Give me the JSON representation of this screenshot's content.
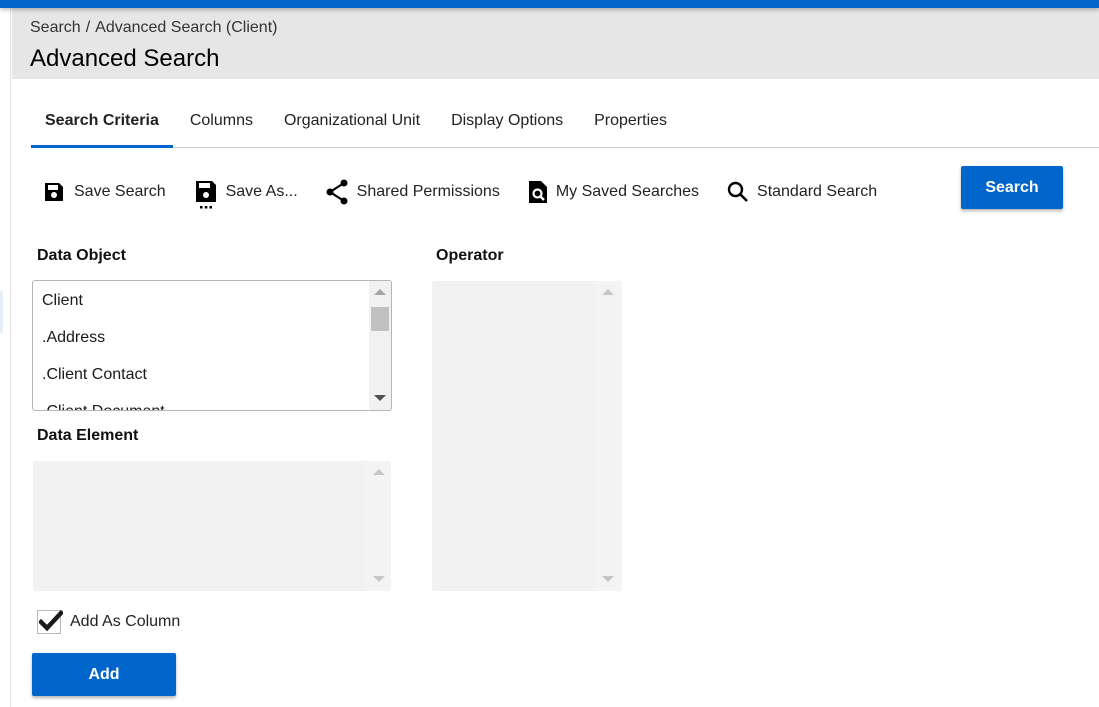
{
  "breadcrumb": {
    "items": [
      "Search",
      "Advanced Search (Client)"
    ],
    "separator": "/"
  },
  "page": {
    "title": "Advanced Search"
  },
  "tabs": [
    {
      "label": "Search Criteria",
      "active": true
    },
    {
      "label": "Columns",
      "active": false
    },
    {
      "label": "Organizational Unit",
      "active": false
    },
    {
      "label": "Display Options",
      "active": false
    },
    {
      "label": "Properties",
      "active": false
    }
  ],
  "toolbar": {
    "save_search": {
      "label": "Save Search",
      "icon": "floppy-disk-icon"
    },
    "save_as": {
      "label": "Save As...",
      "icon": "floppy-disk-more-icon"
    },
    "shared_permissions": {
      "label": "Shared Permissions",
      "icon": "share-icon"
    },
    "my_saved_searches": {
      "label": "My Saved Searches",
      "icon": "document-search-icon"
    },
    "standard_search": {
      "label": "Standard Search",
      "icon": "magnifier-icon"
    },
    "search_button": "Search"
  },
  "form": {
    "data_object": {
      "label": "Data Object",
      "options": [
        "Client",
        ".Address",
        ".Client Contact",
        ".Client Document"
      ]
    },
    "data_element": {
      "label": "Data Element",
      "options": []
    },
    "operator": {
      "label": "Operator",
      "options": []
    },
    "add_as_column": {
      "label": "Add As Column",
      "checked": true
    },
    "add_button": "Add"
  },
  "colors": {
    "accent": "#0066cc",
    "header_bg": "#e6e6e6",
    "disabled_list_bg": "#f2f2f2"
  }
}
